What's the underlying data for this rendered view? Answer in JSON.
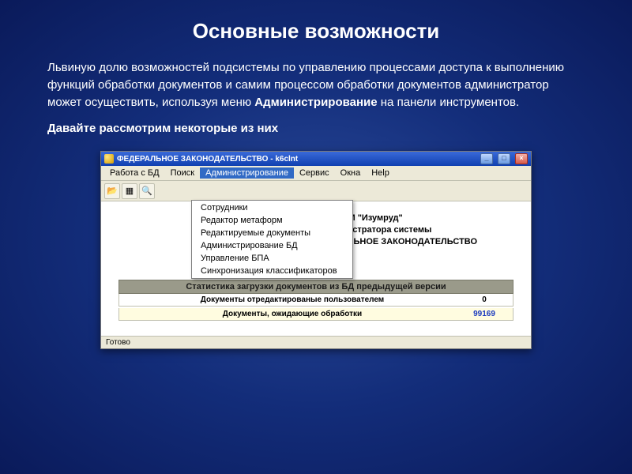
{
  "slide": {
    "title": "Основные возможности",
    "paragraph_pre": "Львиную долю возможностей подсистемы по управлению процессами доступа к выполнению функций обработки документов и самим процессом обработки документов администратор может осуществить, используя меню ",
    "paragraph_bold": "Администрирование",
    "paragraph_post": " на панели инструментов.",
    "paragraph2": "Давайте рассмотрим некоторые из них"
  },
  "app": {
    "title": "ФЕДЕРАЛЬНОЕ ЗАКОНОДАТЕЛЬСТВО - k6clnt",
    "menubar": {
      "items": [
        "Работа с БД",
        "Поиск",
        "Администрирование",
        "Сервис",
        "Окна",
        "Help"
      ],
      "active_index": 2
    },
    "dropdown": {
      "items": [
        "Сотрудники",
        "Редактор метаформ",
        "Редактируемые документы",
        "Администрирование БД",
        "Управление БПА",
        "Синхронизация классификаторов"
      ]
    },
    "header_block": {
      "line1": "ИСПИ \"Изумруд\"",
      "line2": "министратора системы",
      "line3": "ЕРАЛЬНОЕ ЗАКОНОДАТЕЛЬСТВО"
    },
    "stats": {
      "header": "Статистика загрузки документов из БД предыдущей версии",
      "rows": [
        {
          "label": "Документы отредактированые пользователем",
          "value": "0"
        },
        {
          "label": "Документы, ожидающие обработки",
          "value": "99169"
        }
      ]
    },
    "statusbar": "Готово"
  }
}
